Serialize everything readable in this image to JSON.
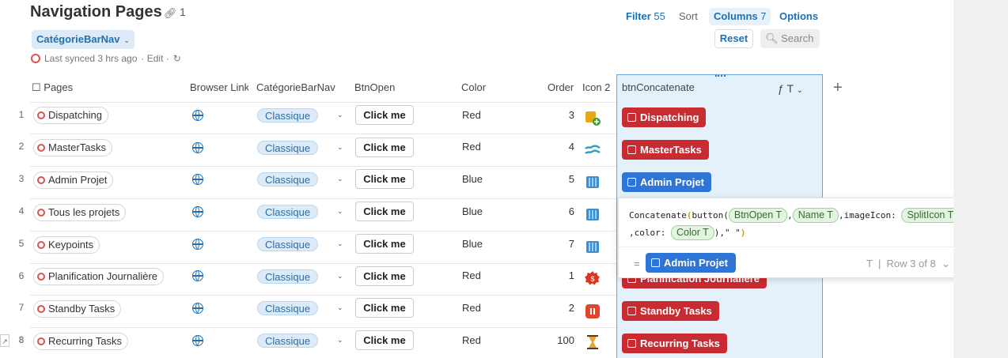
{
  "header": {
    "title": "Navigation Pages",
    "link_count": "1"
  },
  "filter_chip": {
    "label": "CatégorieBarNav"
  },
  "sync": {
    "text": "Last synced 3 hrs ago",
    "edit": "· Edit ·"
  },
  "toolbar": {
    "filter_label": "Filter",
    "filter_count": "55",
    "sort_label": "Sort",
    "columns_label": "Columns",
    "columns_count": "7",
    "options_label": "Options",
    "reset_label": "Reset",
    "search_label": "Search"
  },
  "columns": {
    "pages": "Pages",
    "browser_link": "Browser Link",
    "categorie": "CatégorieBarNav",
    "btnopen": "BtnOpen",
    "color": "Color",
    "order": "Order",
    "icon2": "Icon 2",
    "btnconcat": "btnConcatenate"
  },
  "rows": [
    {
      "num": "1",
      "page": "Dispatching",
      "category": "Classique",
      "btn": "Click me",
      "color": "Red",
      "order": "3",
      "icon": "folder-add-icon",
      "concat": "Dispatching"
    },
    {
      "num": "2",
      "page": "MasterTasks",
      "category": "Classique",
      "btn": "Click me",
      "color": "Red",
      "order": "4",
      "icon": "waves-icon",
      "concat": "MasterTasks"
    },
    {
      "num": "3",
      "page": "Admin Projet",
      "category": "Classique",
      "btn": "Click me",
      "color": "Blue",
      "order": "5",
      "icon": "waterfall-icon",
      "concat": "Admin Projet"
    },
    {
      "num": "4",
      "page": "Tous les projets",
      "category": "Classique",
      "btn": "Click me",
      "color": "Blue",
      "order": "6",
      "icon": "waterfall-icon",
      "concat": ""
    },
    {
      "num": "5",
      "page": "Keypoints",
      "category": "Classique",
      "btn": "Click me",
      "color": "Blue",
      "order": "7",
      "icon": "waterfall-icon",
      "concat": ""
    },
    {
      "num": "6",
      "page": "Planification Journalière",
      "category": "Classique",
      "btn": "Click me",
      "color": "Red",
      "order": "1",
      "icon": "gear-badge-icon",
      "concat": "Planification Journalière"
    },
    {
      "num": "7",
      "page": "Standby Tasks",
      "category": "Classique",
      "btn": "Click me",
      "color": "Red",
      "order": "2",
      "icon": "pause-icon",
      "concat": "Standby Tasks"
    },
    {
      "num": "8",
      "page": "Recurring Tasks",
      "category": "Classique",
      "btn": "Click me",
      "color": "Red",
      "order": "100",
      "icon": "hourglass-icon",
      "concat": "Recurring Tasks"
    }
  ],
  "formula": {
    "fn": "Concatenate",
    "button": "button",
    "tok_btnopen": "BtnOpen T",
    "tok_name": "Name T",
    "image_label": ",imageIcon:",
    "tok_split": "SplitIcon T",
    "color_label": ",color:",
    "tok_color": "Color T",
    "tail": ",\" \"",
    "result": "Admin Projet",
    "row_info": "Row 3 of 8"
  },
  "colors": {
    "red_pill": "#c62c32",
    "blue_pill": "#2f75d6",
    "accent": "#1f6fb2"
  }
}
